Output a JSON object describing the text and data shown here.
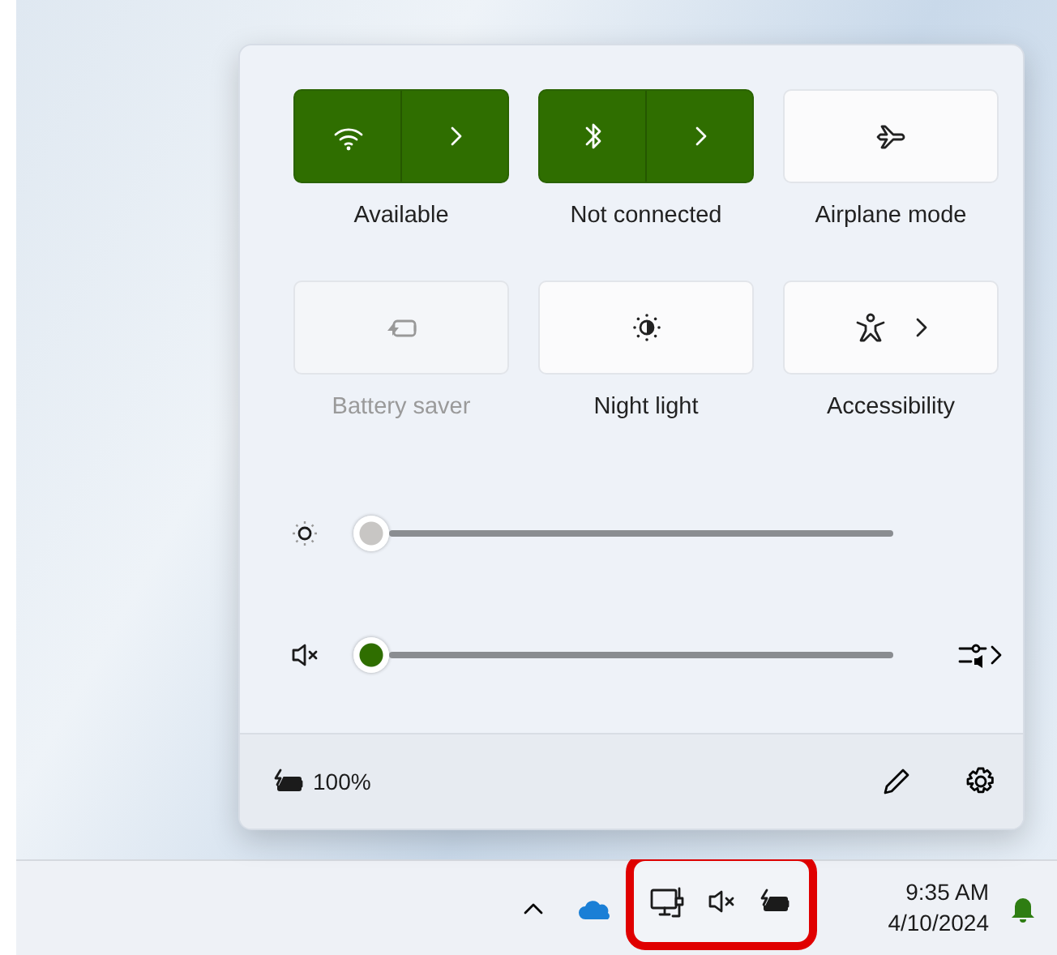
{
  "quick_settings": {
    "tiles": [
      {
        "kind": "split",
        "label": "Available",
        "on": true,
        "disabled": false
      },
      {
        "kind": "split",
        "label": "Not connected",
        "on": true,
        "disabled": false
      },
      {
        "kind": "plain",
        "label": "Airplane mode",
        "on": false,
        "disabled": false
      },
      {
        "kind": "plain",
        "label": "Battery saver",
        "on": false,
        "disabled": true
      },
      {
        "kind": "plain",
        "label": "Night light",
        "on": false,
        "disabled": false
      },
      {
        "kind": "expand",
        "label": "Accessibility",
        "on": false,
        "disabled": false
      }
    ],
    "sliders": [
      {
        "kind": "brightness",
        "level": 0,
        "disabled": true
      },
      {
        "kind": "volume",
        "level": 0,
        "disabled": false
      }
    ],
    "footer": {
      "battery": "100%"
    }
  },
  "taskbar": {
    "tray_highlighted": true,
    "time": "9:35 AM",
    "date": "4/10/2024"
  }
}
